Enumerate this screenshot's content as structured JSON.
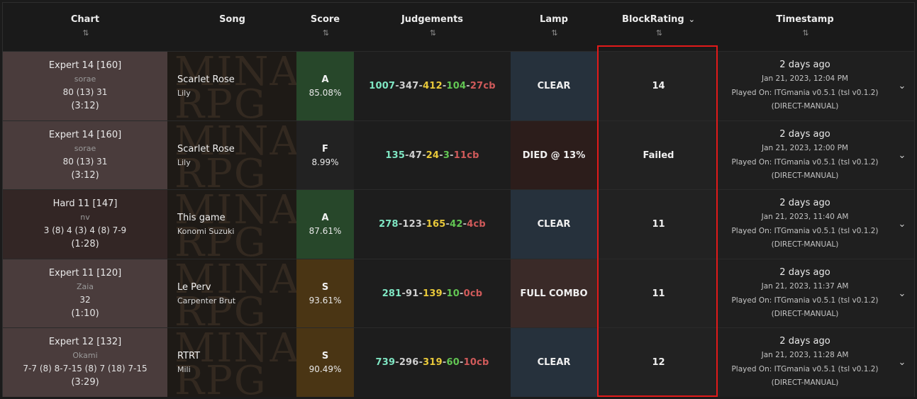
{
  "headers": {
    "chart": "Chart",
    "song": "Song",
    "score": "Score",
    "judgements": "Judgements",
    "lamp": "Lamp",
    "blockrating": "BlockRating",
    "timestamp": "Timestamp",
    "sort_icon": "⇅",
    "dropdown_icon": "⌄"
  },
  "colors": {
    "grade_A_bg": "#27472a",
    "grade_F_bg": "#222222",
    "grade_S_bg": "#4a3514",
    "lamp_clear_bg": "#26313c",
    "lamp_died_bg": "#2c1d1b",
    "lamp_fc_bg": "#3a2a28",
    "highlight_border": "#e21a1a"
  },
  "rows": [
    {
      "chart": {
        "name": "Expert 14 [160]",
        "author": "sorae",
        "breakdown": "80 (13) 31",
        "length": "(3:12)",
        "bg": "#4a3c3c"
      },
      "song": {
        "bg_text": "MINA RPG",
        "title": "Scarlet Rose",
        "artist": "Lily"
      },
      "score": {
        "grade": "A",
        "percent": "85.08%",
        "bg": "#27472a"
      },
      "judgements": {
        "fantastic": "1007",
        "excellent": "347",
        "great": "412",
        "decent": "104",
        "cb": "27cb"
      },
      "lamp": {
        "label": "CLEAR",
        "bg": "#26313c"
      },
      "blockrating": "14",
      "timestamp": {
        "ago": "2 days ago",
        "date": "Jan 21, 2023, 12:04 PM",
        "played_on": "Played On: ITGmania v0.5.1 (tsl v0.1.2)",
        "method": "(DIRECT-MANUAL)"
      }
    },
    {
      "chart": {
        "name": "Expert 14 [160]",
        "author": "sorae",
        "breakdown": "80 (13) 31",
        "length": "(3:12)",
        "bg": "#4a3c3c"
      },
      "song": {
        "bg_text": "MINA RPG",
        "title": "Scarlet Rose",
        "artist": "Lily"
      },
      "score": {
        "grade": "F",
        "percent": "8.99%",
        "bg": "#222222"
      },
      "judgements": {
        "fantastic": "135",
        "excellent": "47",
        "great": "24",
        "decent": "3",
        "cb": "11cb"
      },
      "lamp": {
        "label": "DIED @ 13%",
        "bg": "#2c1d1b"
      },
      "blockrating": "Failed",
      "timestamp": {
        "ago": "2 days ago",
        "date": "Jan 21, 2023, 12:00 PM",
        "played_on": "Played On: ITGmania v0.5.1 (tsl v0.1.2)",
        "method": "(DIRECT-MANUAL)"
      }
    },
    {
      "chart": {
        "name": "Hard 11 [147]",
        "author": "nv",
        "breakdown": "3 (8) 4 (3) 4 (8) 7-9",
        "length": "(1:28)",
        "bg": "#332625"
      },
      "song": {
        "bg_text": "MINA RPG",
        "title": "This game",
        "artist": "Konomi Suzuki"
      },
      "score": {
        "grade": "A",
        "percent": "87.61%",
        "bg": "#27472a"
      },
      "judgements": {
        "fantastic": "278",
        "excellent": "123",
        "great": "165",
        "decent": "42",
        "cb": "4cb"
      },
      "lamp": {
        "label": "CLEAR",
        "bg": "#26313c"
      },
      "blockrating": "11",
      "timestamp": {
        "ago": "2 days ago",
        "date": "Jan 21, 2023, 11:40 AM",
        "played_on": "Played On: ITGmania v0.5.1 (tsl v0.1.2)",
        "method": "(DIRECT-MANUAL)"
      }
    },
    {
      "chart": {
        "name": "Expert 11 [120]",
        "author": "Zaia",
        "breakdown": "32",
        "length": "(1:10)",
        "bg": "#4a3c3c"
      },
      "song": {
        "bg_text": "MINA RPG",
        "title": "Le Perv",
        "artist": "Carpenter Brut"
      },
      "score": {
        "grade": "S",
        "percent": "93.61%",
        "bg": "#4a3514"
      },
      "judgements": {
        "fantastic": "281",
        "excellent": "91",
        "great": "139",
        "decent": "10",
        "cb": "0cb"
      },
      "lamp": {
        "label": "FULL COMBO",
        "bg": "#3a2a28"
      },
      "blockrating": "11",
      "timestamp": {
        "ago": "2 days ago",
        "date": "Jan 21, 2023, 11:37 AM",
        "played_on": "Played On: ITGmania v0.5.1 (tsl v0.1.2)",
        "method": "(DIRECT-MANUAL)"
      }
    },
    {
      "chart": {
        "name": "Expert 12 [132]",
        "author": "Okami",
        "breakdown": "7-7 (8) 8-7-15 (8) 7 (18) 7-15",
        "length": "(3:29)",
        "bg": "#4a3c3c"
      },
      "song": {
        "bg_text": "MINA RPG",
        "title": "RTRT",
        "artist": "Mili"
      },
      "score": {
        "grade": "S",
        "percent": "90.49%",
        "bg": "#4a3514"
      },
      "judgements": {
        "fantastic": "739",
        "excellent": "296",
        "great": "319",
        "decent": "60",
        "cb": "10cb"
      },
      "lamp": {
        "label": "CLEAR",
        "bg": "#26313c"
      },
      "blockrating": "12",
      "timestamp": {
        "ago": "2 days ago",
        "date": "Jan 21, 2023, 11:28 AM",
        "played_on": "Played On: ITGmania v0.5.1 (tsl v0.1.2)",
        "method": "(DIRECT-MANUAL)"
      }
    }
  ]
}
